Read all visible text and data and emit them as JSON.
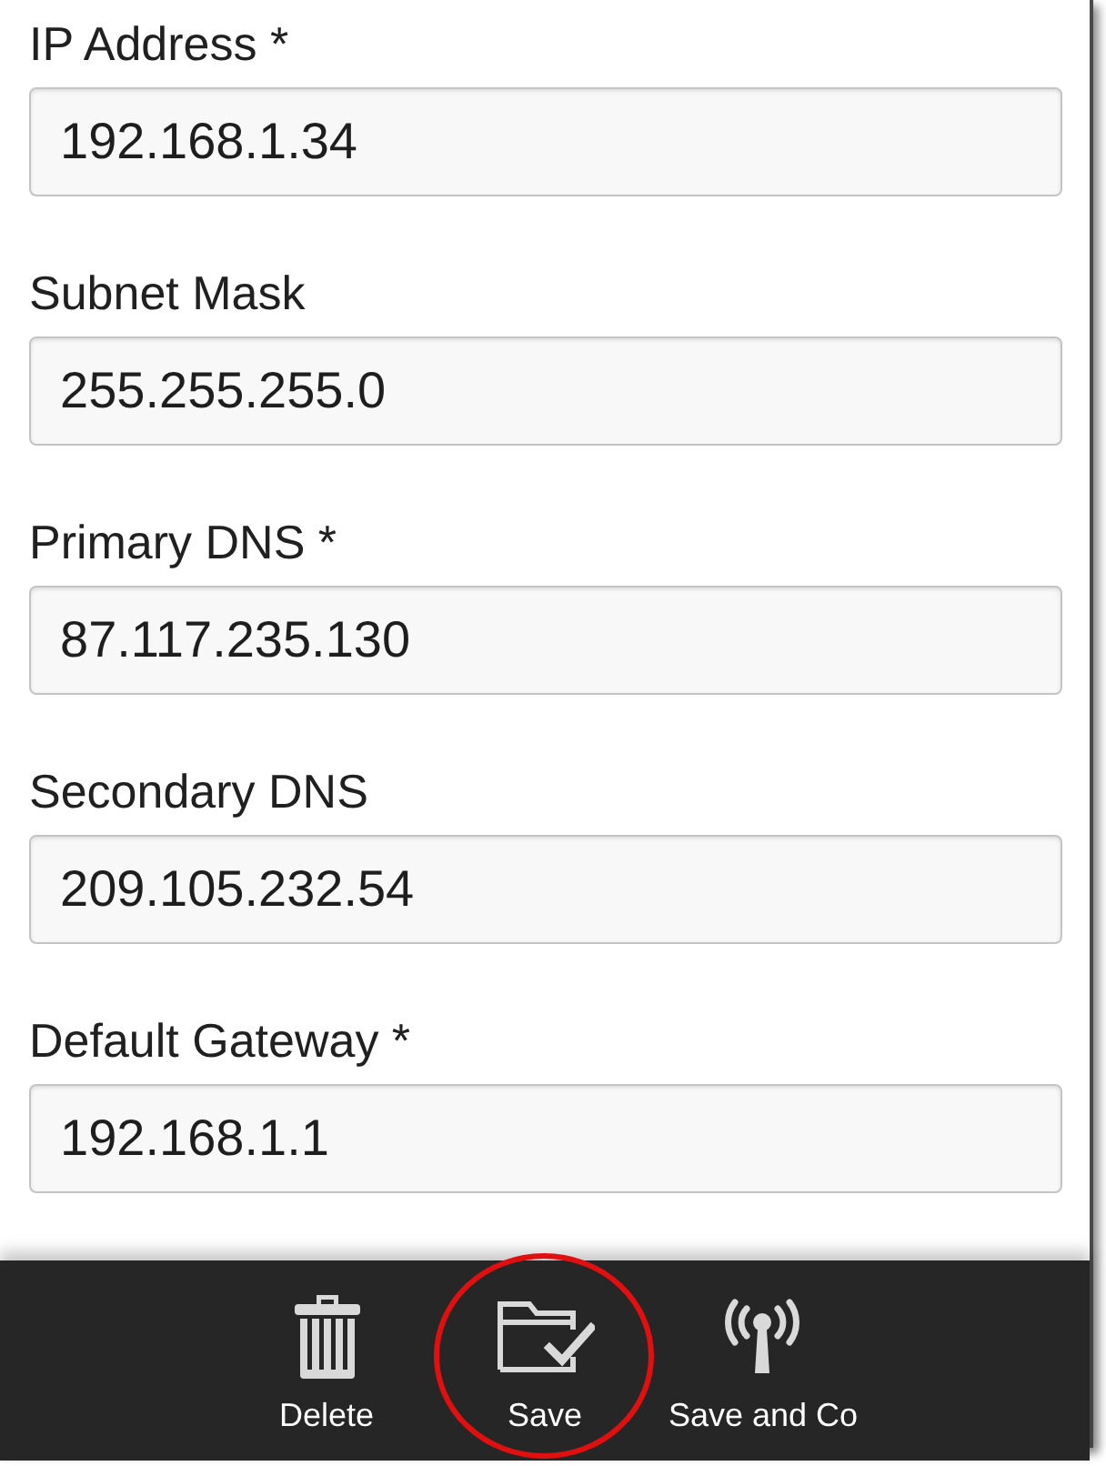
{
  "fields": [
    {
      "label": "IP Address *",
      "value": "192.168.1.34"
    },
    {
      "label": "Subnet Mask",
      "value": "255.255.255.0"
    },
    {
      "label": "Primary DNS *",
      "value": "87.117.235.130"
    },
    {
      "label": "Secondary DNS",
      "value": "209.105.232.54"
    },
    {
      "label": "Default Gateway *",
      "value": "192.168.1.1"
    }
  ],
  "action_bar": {
    "actions": [
      {
        "kind": "delete",
        "label": "Delete",
        "highlighted": false
      },
      {
        "kind": "save",
        "label": "Save",
        "highlighted": true
      },
      {
        "kind": "save_connect",
        "label": "Save and Co",
        "highlighted": false
      }
    ]
  }
}
